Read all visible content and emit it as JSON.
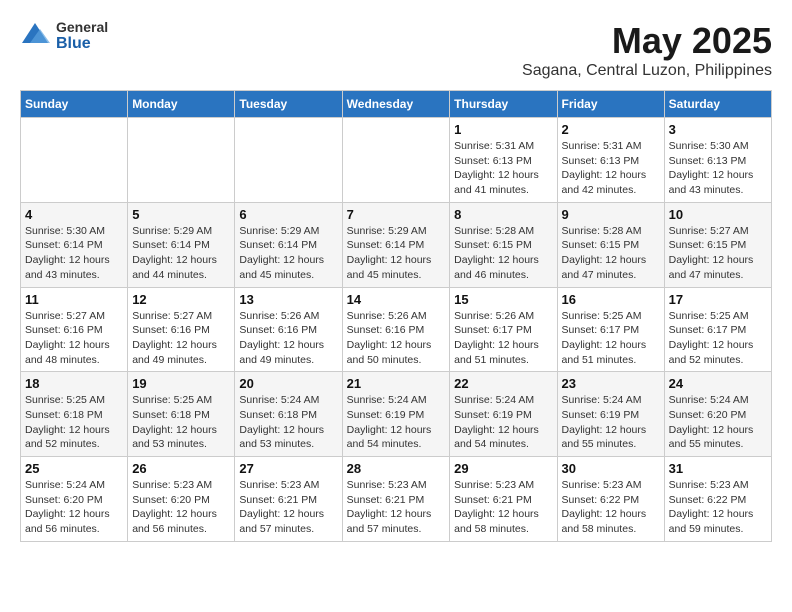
{
  "logo": {
    "general": "General",
    "blue": "Blue"
  },
  "title": "May 2025",
  "subtitle": "Sagana, Central Luzon, Philippines",
  "days_of_week": [
    "Sunday",
    "Monday",
    "Tuesday",
    "Wednesday",
    "Thursday",
    "Friday",
    "Saturday"
  ],
  "weeks": [
    [
      {
        "day": "",
        "info": ""
      },
      {
        "day": "",
        "info": ""
      },
      {
        "day": "",
        "info": ""
      },
      {
        "day": "",
        "info": ""
      },
      {
        "day": "1",
        "info": "Sunrise: 5:31 AM\nSunset: 6:13 PM\nDaylight: 12 hours\nand 41 minutes."
      },
      {
        "day": "2",
        "info": "Sunrise: 5:31 AM\nSunset: 6:13 PM\nDaylight: 12 hours\nand 42 minutes."
      },
      {
        "day": "3",
        "info": "Sunrise: 5:30 AM\nSunset: 6:13 PM\nDaylight: 12 hours\nand 43 minutes."
      }
    ],
    [
      {
        "day": "4",
        "info": "Sunrise: 5:30 AM\nSunset: 6:14 PM\nDaylight: 12 hours\nand 43 minutes."
      },
      {
        "day": "5",
        "info": "Sunrise: 5:29 AM\nSunset: 6:14 PM\nDaylight: 12 hours\nand 44 minutes."
      },
      {
        "day": "6",
        "info": "Sunrise: 5:29 AM\nSunset: 6:14 PM\nDaylight: 12 hours\nand 45 minutes."
      },
      {
        "day": "7",
        "info": "Sunrise: 5:29 AM\nSunset: 6:14 PM\nDaylight: 12 hours\nand 45 minutes."
      },
      {
        "day": "8",
        "info": "Sunrise: 5:28 AM\nSunset: 6:15 PM\nDaylight: 12 hours\nand 46 minutes."
      },
      {
        "day": "9",
        "info": "Sunrise: 5:28 AM\nSunset: 6:15 PM\nDaylight: 12 hours\nand 47 minutes."
      },
      {
        "day": "10",
        "info": "Sunrise: 5:27 AM\nSunset: 6:15 PM\nDaylight: 12 hours\nand 47 minutes."
      }
    ],
    [
      {
        "day": "11",
        "info": "Sunrise: 5:27 AM\nSunset: 6:16 PM\nDaylight: 12 hours\nand 48 minutes."
      },
      {
        "day": "12",
        "info": "Sunrise: 5:27 AM\nSunset: 6:16 PM\nDaylight: 12 hours\nand 49 minutes."
      },
      {
        "day": "13",
        "info": "Sunrise: 5:26 AM\nSunset: 6:16 PM\nDaylight: 12 hours\nand 49 minutes."
      },
      {
        "day": "14",
        "info": "Sunrise: 5:26 AM\nSunset: 6:16 PM\nDaylight: 12 hours\nand 50 minutes."
      },
      {
        "day": "15",
        "info": "Sunrise: 5:26 AM\nSunset: 6:17 PM\nDaylight: 12 hours\nand 51 minutes."
      },
      {
        "day": "16",
        "info": "Sunrise: 5:25 AM\nSunset: 6:17 PM\nDaylight: 12 hours\nand 51 minutes."
      },
      {
        "day": "17",
        "info": "Sunrise: 5:25 AM\nSunset: 6:17 PM\nDaylight: 12 hours\nand 52 minutes."
      }
    ],
    [
      {
        "day": "18",
        "info": "Sunrise: 5:25 AM\nSunset: 6:18 PM\nDaylight: 12 hours\nand 52 minutes."
      },
      {
        "day": "19",
        "info": "Sunrise: 5:25 AM\nSunset: 6:18 PM\nDaylight: 12 hours\nand 53 minutes."
      },
      {
        "day": "20",
        "info": "Sunrise: 5:24 AM\nSunset: 6:18 PM\nDaylight: 12 hours\nand 53 minutes."
      },
      {
        "day": "21",
        "info": "Sunrise: 5:24 AM\nSunset: 6:19 PM\nDaylight: 12 hours\nand 54 minutes."
      },
      {
        "day": "22",
        "info": "Sunrise: 5:24 AM\nSunset: 6:19 PM\nDaylight: 12 hours\nand 54 minutes."
      },
      {
        "day": "23",
        "info": "Sunrise: 5:24 AM\nSunset: 6:19 PM\nDaylight: 12 hours\nand 55 minutes."
      },
      {
        "day": "24",
        "info": "Sunrise: 5:24 AM\nSunset: 6:20 PM\nDaylight: 12 hours\nand 55 minutes."
      }
    ],
    [
      {
        "day": "25",
        "info": "Sunrise: 5:24 AM\nSunset: 6:20 PM\nDaylight: 12 hours\nand 56 minutes."
      },
      {
        "day": "26",
        "info": "Sunrise: 5:23 AM\nSunset: 6:20 PM\nDaylight: 12 hours\nand 56 minutes."
      },
      {
        "day": "27",
        "info": "Sunrise: 5:23 AM\nSunset: 6:21 PM\nDaylight: 12 hours\nand 57 minutes."
      },
      {
        "day": "28",
        "info": "Sunrise: 5:23 AM\nSunset: 6:21 PM\nDaylight: 12 hours\nand 57 minutes."
      },
      {
        "day": "29",
        "info": "Sunrise: 5:23 AM\nSunset: 6:21 PM\nDaylight: 12 hours\nand 58 minutes."
      },
      {
        "day": "30",
        "info": "Sunrise: 5:23 AM\nSunset: 6:22 PM\nDaylight: 12 hours\nand 58 minutes."
      },
      {
        "day": "31",
        "info": "Sunrise: 5:23 AM\nSunset: 6:22 PM\nDaylight: 12 hours\nand 59 minutes."
      }
    ]
  ]
}
